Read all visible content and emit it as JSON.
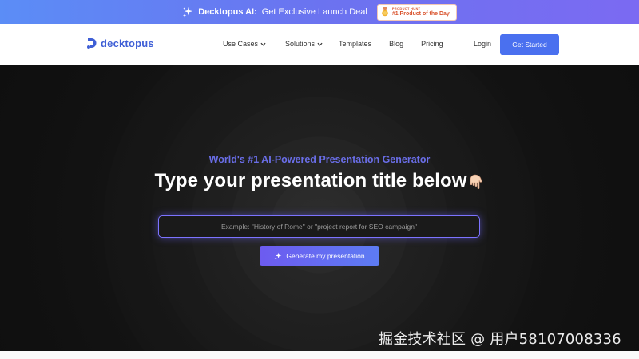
{
  "promo": {
    "brand": "Decktopus AI:",
    "text": "Get Exclusive Launch Deal",
    "badge_small": "PRODUCT HUNT",
    "badge_big": "#1 Product of the Day"
  },
  "header": {
    "logo": "decktopus",
    "nav": {
      "use_cases": "Use Cases",
      "solutions": "Solutions",
      "templates": "Templates",
      "blog": "Blog",
      "pricing": "Pricing"
    },
    "login": "Login",
    "cta": "Get Started"
  },
  "hero": {
    "subtitle": "World's #1 AI-Powered Presentation Generator",
    "title": "Type your presentation title below",
    "input_placeholder": "Example: \"History of Rome\" or \"project report for SEO campaign\"",
    "input_value": "",
    "generate_button": "Generate my presentation"
  },
  "watermark": "掘金技术社区 @ 用户58107008336",
  "colors": {
    "accent": "#4a70ef",
    "brand": "#3f5fd6",
    "subtitle": "#6a6ee8",
    "hero_bg": "#161616"
  }
}
